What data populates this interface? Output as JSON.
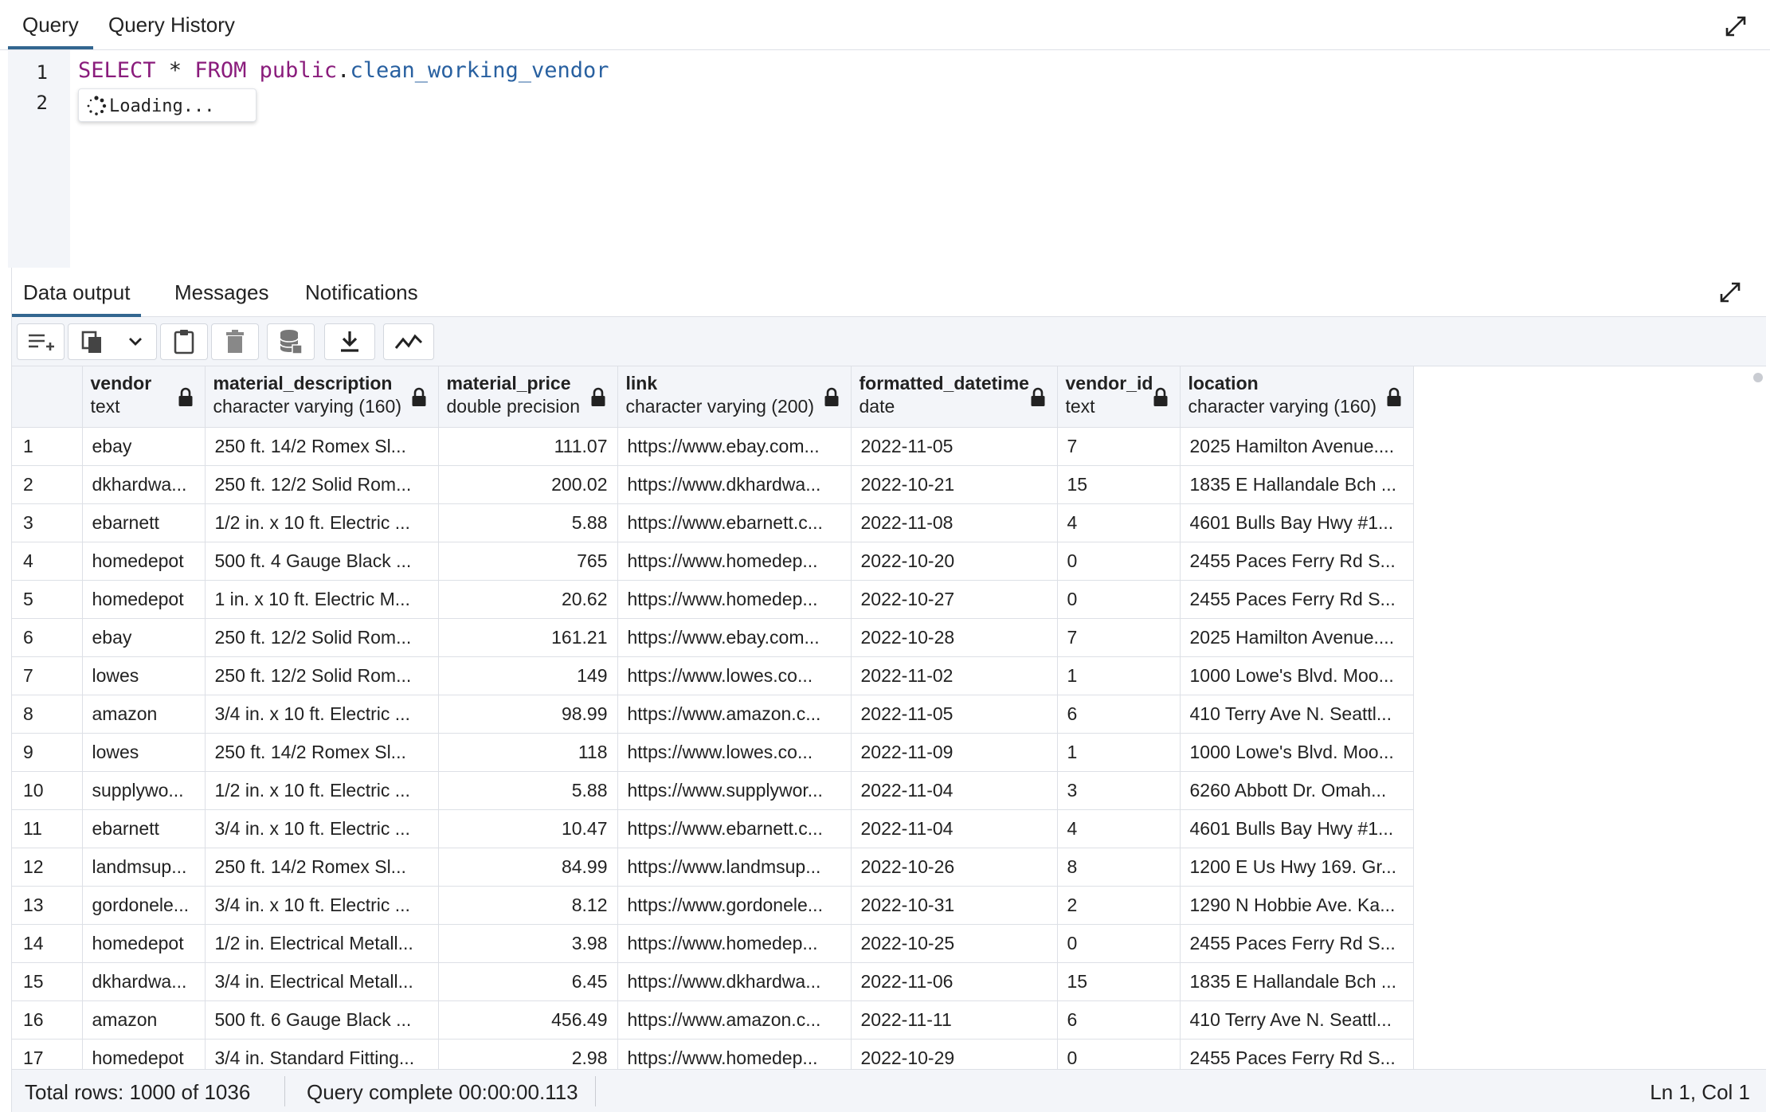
{
  "query_tabs": {
    "query": "Query",
    "history": "Query History"
  },
  "editor": {
    "line_numbers": [
      "1",
      "2"
    ],
    "sql": {
      "kw1": "SELECT",
      "star": " * ",
      "kw2": "FROM",
      "schema": "public",
      "dot": ".",
      "table": "clean_working_vendor"
    },
    "autocomplete": "Loading..."
  },
  "result_tabs": {
    "data_output": "Data output",
    "messages": "Messages",
    "notifications": "Notifications"
  },
  "toolbar": {
    "icons": [
      "add-row-icon",
      "copy-icon",
      "chevron-down-icon",
      "paste-icon",
      "delete-icon",
      "save-data-icon",
      "download-icon",
      "graph-icon"
    ]
  },
  "columns": [
    {
      "name": "vendor",
      "type": "text"
    },
    {
      "name": "material_description",
      "type": "character varying (160)"
    },
    {
      "name": "material_price",
      "type": "double precision"
    },
    {
      "name": "link",
      "type": "character varying (200)"
    },
    {
      "name": "formatted_datetime",
      "type": "date"
    },
    {
      "name": "vendor_id",
      "type": "text"
    },
    {
      "name": "location",
      "type": "character varying (160)"
    }
  ],
  "rows": [
    [
      "1",
      "ebay",
      "250 ft. 14/2 Romex Sl...",
      "111.07",
      "https://www.ebay.com...",
      "2022-11-05",
      "7",
      "2025 Hamilton Avenue...."
    ],
    [
      "2",
      "dkhardwa...",
      "250 ft. 12/2 Solid Rom...",
      "200.02",
      "https://www.dkhardwa...",
      "2022-10-21",
      "15",
      "1835 E Hallandale Bch ..."
    ],
    [
      "3",
      "ebarnett",
      "1/2 in. x 10 ft. Electric ...",
      "5.88",
      "https://www.ebarnett.c...",
      "2022-11-08",
      "4",
      "4601 Bulls Bay Hwy #1..."
    ],
    [
      "4",
      "homedepot",
      "500 ft. 4 Gauge Black ...",
      "765",
      "https://www.homedep...",
      "2022-10-20",
      "0",
      "2455 Paces Ferry Rd S..."
    ],
    [
      "5",
      "homedepot",
      "1 in. x 10 ft. Electric M...",
      "20.62",
      "https://www.homedep...",
      "2022-10-27",
      "0",
      "2455 Paces Ferry Rd S..."
    ],
    [
      "6",
      "ebay",
      "250 ft. 12/2 Solid Rom...",
      "161.21",
      "https://www.ebay.com...",
      "2022-10-28",
      "7",
      "2025 Hamilton Avenue...."
    ],
    [
      "7",
      "lowes",
      "250 ft. 12/2 Solid Rom...",
      "149",
      "https://www.lowes.co...",
      "2022-11-02",
      "1",
      "1000 Lowe's Blvd. Moo..."
    ],
    [
      "8",
      "amazon",
      "3/4 in. x 10 ft. Electric ...",
      "98.99",
      "https://www.amazon.c...",
      "2022-11-05",
      "6",
      "410 Terry Ave N. Seattl..."
    ],
    [
      "9",
      "lowes",
      "250 ft. 14/2 Romex Sl...",
      "118",
      "https://www.lowes.co...",
      "2022-11-09",
      "1",
      "1000 Lowe's Blvd. Moo..."
    ],
    [
      "10",
      "supplywo...",
      "1/2 in. x 10 ft. Electric ...",
      "5.88",
      "https://www.supplywor...",
      "2022-11-04",
      "3",
      "6260 Abbott Dr. Omah..."
    ],
    [
      "11",
      "ebarnett",
      "3/4 in. x 10 ft. Electric ...",
      "10.47",
      "https://www.ebarnett.c...",
      "2022-11-04",
      "4",
      "4601 Bulls Bay Hwy #1..."
    ],
    [
      "12",
      "landmsup...",
      "250 ft. 14/2 Romex Sl...",
      "84.99",
      "https://www.landmsup...",
      "2022-10-26",
      "8",
      "1200 E Us Hwy 169. Gr..."
    ],
    [
      "13",
      "gordonele...",
      "3/4 in. x 10 ft. Electric ...",
      "8.12",
      "https://www.gordonele...",
      "2022-10-31",
      "2",
      "1290 N Hobbie Ave. Ka..."
    ],
    [
      "14",
      "homedepot",
      "1/2 in. Electrical Metall...",
      "3.98",
      "https://www.homedep...",
      "2022-10-25",
      "0",
      "2455 Paces Ferry Rd S..."
    ],
    [
      "15",
      "dkhardwa...",
      "3/4 in. Electrical Metall...",
      "6.45",
      "https://www.dkhardwa...",
      "2022-11-06",
      "15",
      "1835 E Hallandale Bch ..."
    ],
    [
      "16",
      "amazon",
      "500 ft. 6 Gauge Black ...",
      "456.49",
      "https://www.amazon.c...",
      "2022-11-11",
      "6",
      "410 Terry Ave N. Seattl..."
    ],
    [
      "17",
      "homedepot",
      "3/4 in. Standard Fitting...",
      "2.98",
      "https://www.homedep...",
      "2022-10-29",
      "0",
      "2455 Paces Ferry Rd S..."
    ]
  ],
  "status": {
    "total_rows": "Total rows: 1000 of 1036",
    "query_complete": "Query complete 00:00:00.113",
    "cursor": "Ln 1, Col 1"
  },
  "colors": {
    "accent": "#326690",
    "keyword": "#8a1c7c",
    "identifier": "#2860a0"
  }
}
